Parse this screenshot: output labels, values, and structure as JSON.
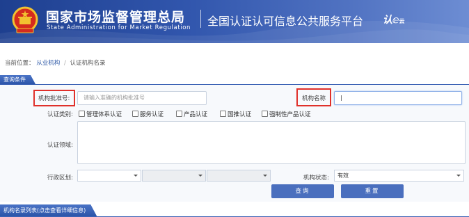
{
  "header": {
    "title_cn": "国家市场监督管理总局",
    "title_en": "State Administration  for  Market Regulation",
    "platform": "全国认证认可信息公共服务平台",
    "logo_text": "认",
    "logo_sub": "云"
  },
  "breadcrumb": {
    "label": "当前位置：",
    "items": [
      "从业机构",
      "认证机构名录"
    ],
    "separator": "/"
  },
  "query": {
    "tab_label": "查询条件",
    "approval_no_label": "机构批准号:",
    "approval_no_placeholder": "请输入准确的机构批准号",
    "org_name_label": "机构名称",
    "org_name_value": "",
    "category_label": "认证类别:",
    "categories": [
      "管理体系认证",
      "服务认证",
      "产品认证",
      "国推认证",
      "强制性产品认证"
    ],
    "field_label": "认证领域:",
    "region_label": "行政区划:",
    "status_label": "机构状态:",
    "status_value": "有效",
    "search_button": "查询",
    "reset_button": "重置"
  },
  "list": {
    "tab_label": "机构名录列表(点击查看详细信息)"
  },
  "colors": {
    "banner": "#2a4ea5",
    "accent": "#4a6fbe",
    "highlight": "#e0302a"
  }
}
